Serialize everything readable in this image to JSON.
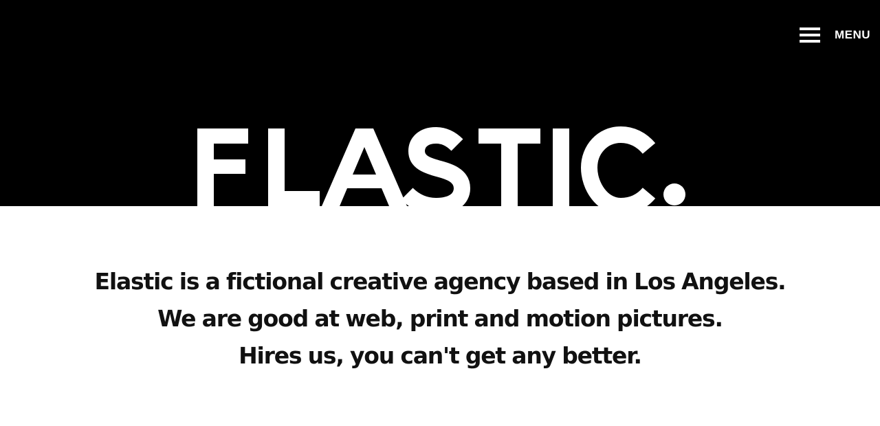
{
  "header": {
    "menu_label": "MENU",
    "menu_icon": "hamburger-icon"
  },
  "hero": {
    "logo_text": "ELASTIC.",
    "background_color": "#000000",
    "logo_color": "#ffffff"
  },
  "intro": {
    "lines": [
      "Elastic is a fictional creative agency based in Los Angeles.",
      "We are good at web, print and motion pictures.",
      "Hires us, you can't get any better."
    ]
  }
}
